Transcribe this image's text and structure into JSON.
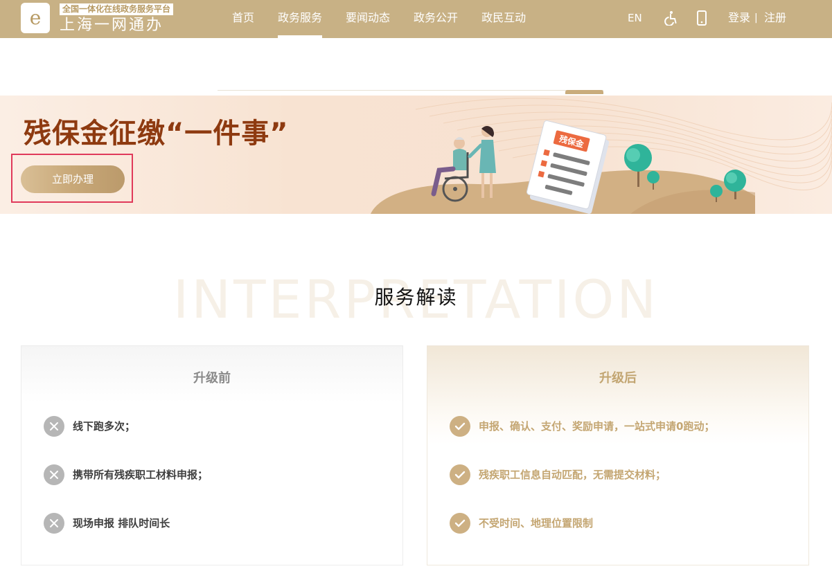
{
  "header": {
    "logo_glyph": "e",
    "logo_tagline": "全国一体化在线政务服务平台",
    "logo_name": "上海一网通办",
    "nav": [
      {
        "label": "首页",
        "active": false
      },
      {
        "label": "政务服务",
        "active": true
      },
      {
        "label": "要闻动态",
        "active": false
      },
      {
        "label": "政务公开",
        "active": false
      },
      {
        "label": "政民互动",
        "active": false
      }
    ],
    "lang_label": "EN",
    "login_label": "登录",
    "separator": "|",
    "register_label": "注册",
    "icons": {
      "accessibility": "wheelchair-icon",
      "mobile": "mobile-phone-icon"
    }
  },
  "banner": {
    "title": "残保金征缴“一件事”",
    "button_label": "立即办理",
    "document_label": "残保金"
  },
  "section": {
    "background_word": "INTERPRETATION",
    "title": "服务解读"
  },
  "before": {
    "title": "升级前",
    "items": [
      "线下跑多次；",
      "携带所有残疾职工材料申报；",
      "现场申报 排队时间长"
    ]
  },
  "after": {
    "title": "升级后",
    "items": [
      "申报、确认、支付、奖励申请，一站式申请0跑动；",
      "残疾职工信息自动匹配，无需提交材料；",
      "不受时间、地理位置限制"
    ]
  },
  "colors": {
    "header_bg": "#c8b185",
    "banner_title": "#8e3a10",
    "accent_gold": "#c2a571",
    "highlight_frame": "#e0395a",
    "muted_gray": "#b6b6b6"
  }
}
